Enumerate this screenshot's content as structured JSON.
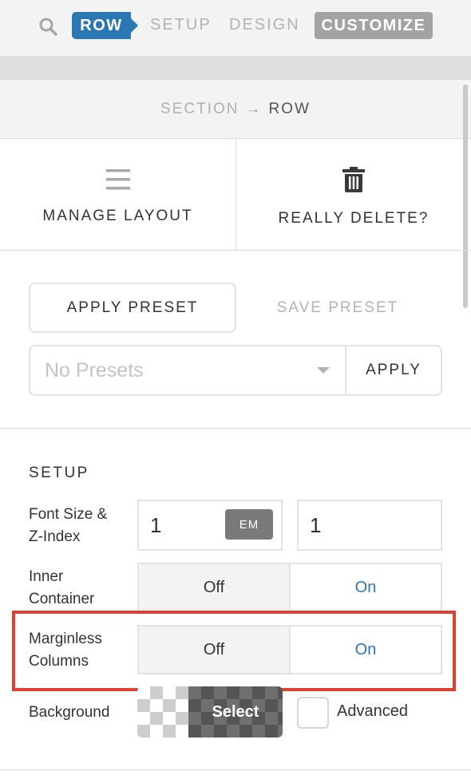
{
  "nav": {
    "tabs": [
      "ROW",
      "SETUP",
      "DESIGN",
      "CUSTOMIZE"
    ],
    "icon": "search-icon"
  },
  "breadcrumb": {
    "section": "SECTION",
    "arrow": "→",
    "row": "ROW"
  },
  "actions": {
    "manage_layout": {
      "label": "MANAGE LAYOUT",
      "icon": "hamburger-icon"
    },
    "really_delete": {
      "label": "REALLY DELETE?",
      "icon": "trash-icon"
    }
  },
  "presets": {
    "apply_preset": "APPLY PRESET",
    "save_preset": "SAVE PRESET",
    "select_value": "No Presets",
    "apply": "APPLY"
  },
  "setup": {
    "heading": "SETUP",
    "font_size_label_1": "Font Size &",
    "font_size_label_2": "Z-Index",
    "font_size_value": "1",
    "font_size_unit": "EM",
    "z_index_value": "1",
    "inner_container_label_1": "Inner",
    "inner_container_label_2": "Container",
    "inner_off": "Off",
    "inner_on": "On",
    "marginless_label_1": "Marginless",
    "marginless_label_2": "Columns",
    "marginless_off": "Off",
    "marginless_on": "On",
    "background_label": "Background",
    "background_select": "Select",
    "advanced_label": "Advanced"
  },
  "colors": {
    "accent": "#2b77b3",
    "highlight": "#e0402e"
  }
}
